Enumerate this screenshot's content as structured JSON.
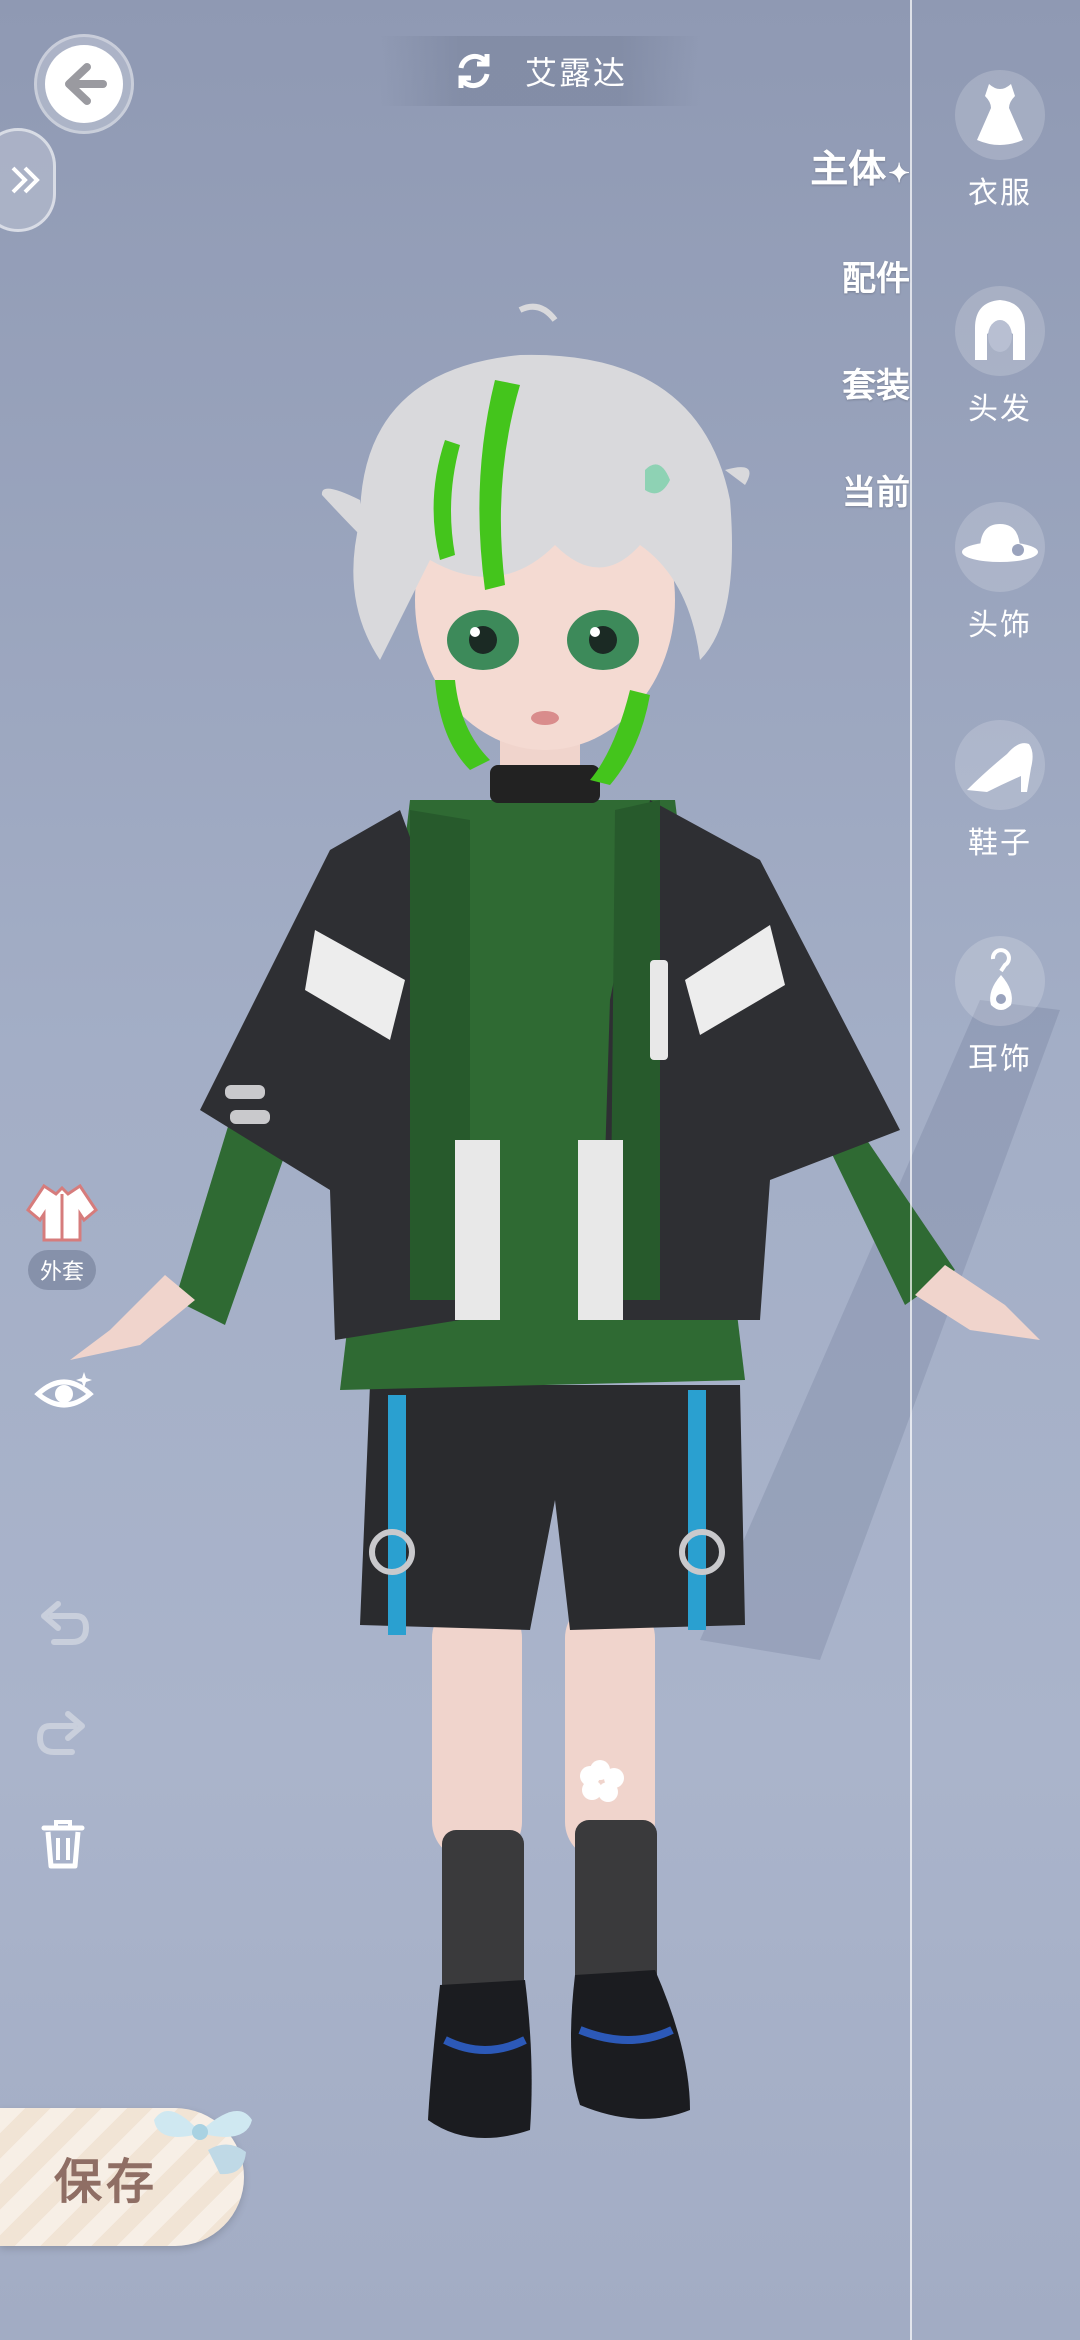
{
  "header": {
    "back_icon": "back-arrow-icon",
    "expand_icon": "double-chevron-right-icon",
    "swap_icon": "refresh-swap-icon",
    "character_name": "艾露达"
  },
  "category_tabs": [
    {
      "label": "主体",
      "active": true
    },
    {
      "label": "配件",
      "active": false
    },
    {
      "label": "套装",
      "active": false
    },
    {
      "label": "当前",
      "active": false
    }
  ],
  "active_marker": "✦",
  "slots": [
    {
      "label": "衣服",
      "icon": "dress-icon"
    },
    {
      "label": "头发",
      "icon": "hair-icon"
    },
    {
      "label": "头饰",
      "icon": "hat-icon"
    },
    {
      "label": "鞋子",
      "icon": "high-heel-icon"
    },
    {
      "label": "耳饰",
      "icon": "earring-icon"
    }
  ],
  "left_tools": {
    "outerwear_label": "外套",
    "outerwear_icon": "jacket-icon",
    "visibility_icon": "eye-sparkle-icon",
    "undo_icon": "undo-icon",
    "redo_icon": "redo-icon",
    "delete_icon": "trash-icon"
  },
  "footer": {
    "save_label": "保存"
  },
  "colors": {
    "background_top": "#8f99b3",
    "background_bottom": "#a2acc4",
    "accent_text": "#ffffff",
    "save_text": "#8f6e64",
    "jacket": "#2e2f33",
    "shirt": "#2f6a33",
    "hair": "#d9d9dc",
    "hair_streak": "#44c51c",
    "trim_blue": "#2aa0d0"
  }
}
